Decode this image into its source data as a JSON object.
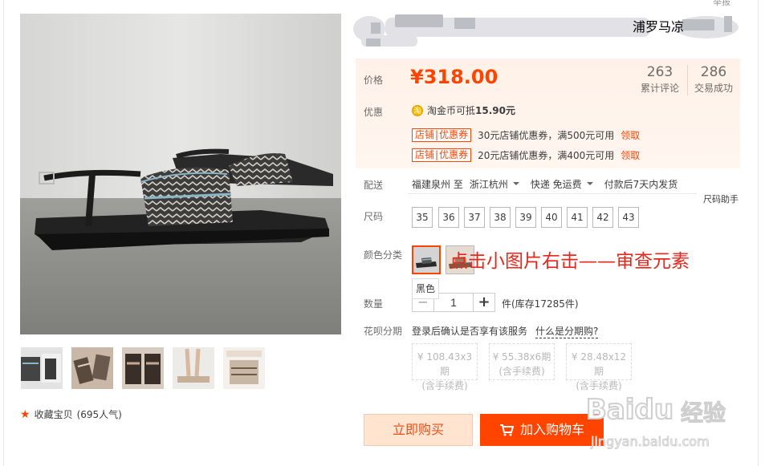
{
  "top_link": "举报",
  "title": {
    "visible_fragment": "浦罗马凉"
  },
  "price": {
    "label": "价格",
    "value": "¥318.00",
    "review_count": "263",
    "review_label": "累计评论",
    "sold_count": "286",
    "sold_label": "交易成功"
  },
  "promo": {
    "label": "优惠",
    "coin_icon": "淘",
    "coin_text_prefix": "淘金币可抵",
    "coin_amount": "15.90元",
    "coupons": [
      {
        "tag_a": "店铺",
        "tag_b": "优惠券",
        "desc": "30元店铺优惠券，满500元可用",
        "link": "领取"
      },
      {
        "tag_a": "店铺",
        "tag_b": "优惠券",
        "desc": "20元店铺优惠券，满400元可用",
        "link": "领取"
      }
    ]
  },
  "delivery": {
    "label": "配送",
    "from": "福建泉州 至",
    "to": "浙江杭州",
    "shipping": "快递 免运费",
    "dispatch": "付款后7天内发货",
    "size_helper": "尺码助手"
  },
  "sizes": {
    "label": "尺码",
    "options": [
      "35",
      "36",
      "37",
      "38",
      "39",
      "40",
      "41",
      "42",
      "43"
    ]
  },
  "colors": {
    "label": "颜色分类",
    "tooltip": "黑色",
    "annotation": "点击小图片右击——审查元素"
  },
  "quantity": {
    "label": "数量",
    "minus": "−",
    "value": "1",
    "plus": "+",
    "stock": "件(库存17285件)"
  },
  "installment": {
    "label": "花呗分期",
    "text": "登录后确认是否享有该服务",
    "link": "什么是分期购?",
    "plans": [
      {
        "amount": "¥ 108.43x3期",
        "fee": "(含手续费)"
      },
      {
        "amount": "¥ 55.38x6期",
        "fee": "(含手续费)"
      },
      {
        "amount": "¥ 28.48x12期",
        "fee": "(含手续费)"
      }
    ]
  },
  "favorite": {
    "text": "收藏宝贝",
    "count": "(695人气)"
  },
  "actions": {
    "buy_now": "立即购买",
    "add_to_cart": "加入购物车"
  },
  "watermark": {
    "brand": "Baidu",
    "cn": "经验",
    "url": "jingyan.baidu.com"
  }
}
